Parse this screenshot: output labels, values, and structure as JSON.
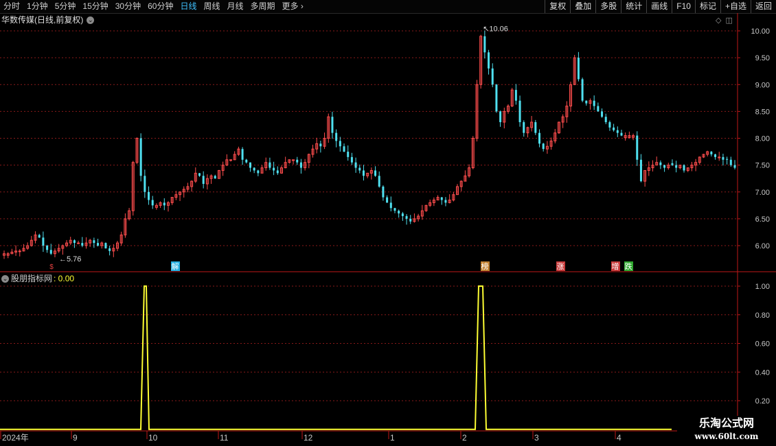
{
  "toolbar": {
    "periods": [
      "分时",
      "1分钟",
      "5分钟",
      "15分钟",
      "30分钟",
      "60分钟",
      "日线",
      "周线",
      "月线",
      "多周期",
      "更多"
    ],
    "active_period": "日线",
    "more_arrow": "›",
    "buttons": [
      "复权",
      "叠加",
      "多股",
      "统计",
      "画线",
      "F10",
      "标记",
      "+自选",
      "返回"
    ]
  },
  "main_panel": {
    "title": "华数传媒(日线,前复权)",
    "dropdown_icon": "chevron-down-icon",
    "price_axis_labels": [
      "10.00",
      "9.50",
      "9.00",
      "8.50",
      "8.00",
      "7.50",
      "7.00",
      "6.50",
      "6.00"
    ],
    "high_marker": "10.06",
    "low_marker": "5.76",
    "events": [
      {
        "label": "解",
        "color": "#22aee0"
      },
      {
        "label": "榜",
        "color": "#c08030"
      },
      {
        "label": "涨",
        "color": "#c83a3a"
      },
      {
        "label": "增",
        "color": "#c83a3a"
      },
      {
        "label": "跌",
        "color": "#2fa82f"
      }
    ]
  },
  "indicator_panel": {
    "name": "股朋指标网",
    "value": ": 0.00",
    "axis_labels": [
      "1.00",
      "0.80",
      "0.60",
      "0.40",
      "0.20"
    ]
  },
  "time_axis": {
    "labels": [
      "2024年",
      "9",
      "10",
      "11",
      "12",
      "1",
      "2",
      "3",
      "4"
    ]
  },
  "watermark": {
    "line1": "乐淘公式网",
    "line2": "www.60lt.com"
  },
  "colors": {
    "up": "#ff4d4d",
    "down": "#4fe0f0",
    "indicator": "#ffff33",
    "grid": "#8b1a1a",
    "axis": "#c01818",
    "active": "#3fc1ff"
  },
  "chart_data": [
    {
      "type": "candlestick",
      "title": "华数传媒(日线,前复权)",
      "ylim": [
        5.5,
        10.2
      ],
      "x_ticks": [
        "2024年",
        "9",
        "10",
        "11",
        "12",
        "1",
        "2",
        "3",
        "4"
      ],
      "y_ticks": [
        6.0,
        6.5,
        7.0,
        7.5,
        8.0,
        8.5,
        9.0,
        9.5,
        10.0
      ],
      "series": [
        {
          "values": [
            5.85,
            5.85,
            5.88,
            5.9,
            5.9,
            5.95,
            6.0,
            6.1,
            6.2,
            6.15,
            6.0,
            5.92,
            5.85,
            5.9,
            5.95,
            6.0,
            6.05,
            6.1,
            6.05,
            6.05,
            6.0,
            6.05,
            6.1,
            6.05,
            6.0,
            6.05,
            5.95,
            5.9,
            5.95,
            6.05,
            6.2,
            6.5,
            6.65,
            7.55,
            8.0,
            7.3,
            7.0,
            6.85,
            6.75,
            6.75,
            6.8,
            6.75,
            6.8,
            6.9,
            6.95,
            7.0,
            7.05,
            7.1,
            7.2,
            7.35,
            7.3,
            7.15,
            7.25,
            7.3,
            7.25,
            7.4,
            7.5,
            7.6,
            7.6,
            7.7,
            7.8,
            7.6,
            7.55,
            7.45,
            7.4,
            7.35,
            7.45,
            7.55,
            7.45,
            7.4,
            7.35,
            7.45,
            7.55,
            7.6,
            7.6,
            7.55,
            7.45,
            7.55,
            7.7,
            7.8,
            7.9,
            7.85,
            8.0,
            8.4,
            8.1,
            7.95,
            7.85,
            7.75,
            7.65,
            7.55,
            7.45,
            7.4,
            7.3,
            7.35,
            7.4,
            7.3,
            7.1,
            6.9,
            6.8,
            6.7,
            6.65,
            6.6,
            6.55,
            6.5,
            6.45,
            6.5,
            6.55,
            6.65,
            6.75,
            6.8,
            6.85,
            6.9,
            6.85,
            6.8,
            6.85,
            6.95,
            7.1,
            7.2,
            7.3,
            7.45,
            8.0,
            9.0,
            9.9,
            9.6,
            9.3,
            9.0,
            8.5,
            8.3,
            8.5,
            8.6,
            8.9,
            8.7,
            8.3,
            8.1,
            8.2,
            8.3,
            8.1,
            7.9,
            7.8,
            7.85,
            7.95,
            8.1,
            8.3,
            8.4,
            8.6,
            9.0,
            9.5,
            9.1,
            8.7,
            8.65,
            8.7,
            8.6,
            8.5,
            8.4,
            8.3,
            8.2,
            8.15,
            8.1,
            8.05,
            8.05,
            8.05,
            8.05,
            7.6,
            7.2,
            7.4,
            7.45,
            7.5,
            7.55,
            7.5,
            7.45,
            7.5,
            7.5,
            7.45,
            7.5,
            7.4,
            7.45,
            7.5,
            7.55,
            7.65,
            7.7,
            7.75,
            7.7,
            7.65,
            7.65,
            7.6,
            7.6,
            7.5,
            7.45
          ]
        }
      ]
    },
    {
      "type": "line",
      "title": "股朋指标网",
      "ylim": [
        0,
        1.05
      ],
      "y_ticks": [
        1.0,
        0.8,
        0.6,
        0.4,
        0.2
      ],
      "series": [
        {
          "name": "股朋指标网",
          "values": "0 everywhere except 1.00 at two spikes (early Oct 2024, Feb 2025)"
        }
      ]
    }
  ]
}
